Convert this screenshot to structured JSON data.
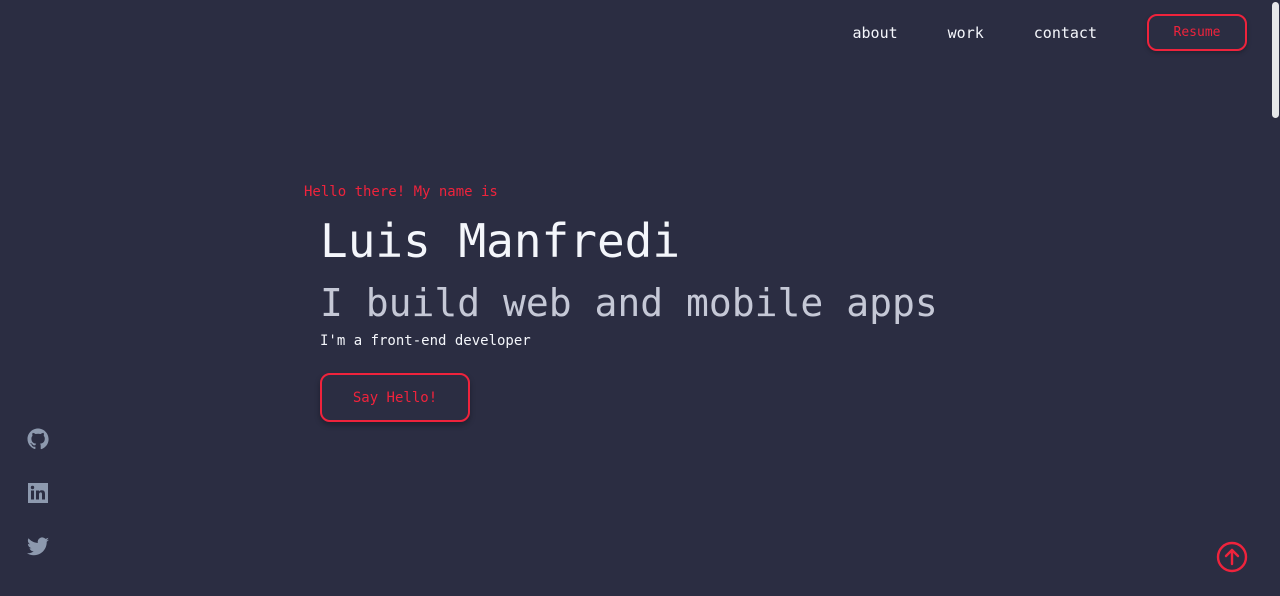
{
  "nav": {
    "links": [
      {
        "label": "about"
      },
      {
        "label": "work"
      },
      {
        "label": "contact"
      }
    ],
    "resume_label": "Resume"
  },
  "hero": {
    "greeting": "Hello there! My name is",
    "name": "Luis Manfredi",
    "tagline": "I build web and mobile apps",
    "subtitle": "I'm a front-end developer",
    "cta_label": "Say Hello!"
  },
  "social": [
    {
      "icon": "github-icon"
    },
    {
      "icon": "linkedin-icon"
    },
    {
      "icon": "twitter-icon"
    }
  ],
  "back_to_top_icon": "arrow-up-circle-icon",
  "colors": {
    "background": "#2b2d42",
    "accent": "#ef233c",
    "text": "#f4f6fb",
    "muted": "#8d99ae"
  }
}
